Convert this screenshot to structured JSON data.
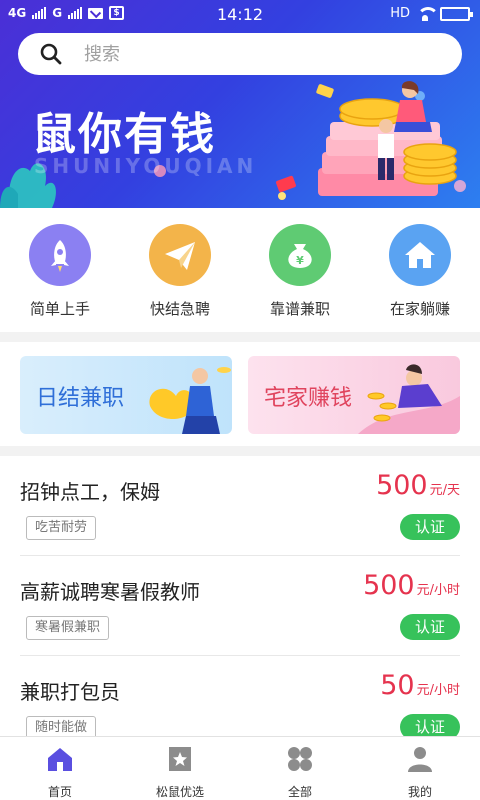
{
  "status_bar": {
    "network1": "4G",
    "network2": "G",
    "time": "14:12",
    "hd": "HD"
  },
  "search": {
    "placeholder": "搜索"
  },
  "banner": {
    "title": "鼠你有钱",
    "subtitle": "SHUNIYOUQIAN"
  },
  "categories": [
    {
      "label": "简单上手",
      "icon": "rocket-icon",
      "color": "#8b80f2"
    },
    {
      "label": "快结急聘",
      "icon": "paper-plane-icon",
      "color": "#f3b44a"
    },
    {
      "label": "靠谱兼职",
      "icon": "money-bag-icon",
      "color": "#5fcb73"
    },
    {
      "label": "在家躺赚",
      "icon": "home-icon",
      "color": "#5aa3f2"
    }
  ],
  "promos": [
    {
      "label": "日结兼职",
      "color": "#2f6fd8"
    },
    {
      "label": "宅家赚钱",
      "color": "#e0445e"
    }
  ],
  "jobs": [
    {
      "title": "招钟点工，保姆",
      "salary": "500",
      "unit": "元/天",
      "tag": "吃苦耐劳",
      "badge": "认证"
    },
    {
      "title": "高薪诚聘寒暑假教师",
      "salary": "500",
      "unit": "元/小时",
      "tag": "寒暑假兼职",
      "badge": "认证"
    },
    {
      "title": "兼职打包员",
      "salary": "50",
      "unit": "元/小时",
      "tag": "随时能做",
      "badge": "认证"
    }
  ],
  "bottom_nav": [
    {
      "label": "首页",
      "icon": "home-icon",
      "active": true
    },
    {
      "label": "松鼠优选",
      "icon": "star-icon",
      "active": false
    },
    {
      "label": "全部",
      "icon": "grid-icon",
      "active": false
    },
    {
      "label": "我的",
      "icon": "user-icon",
      "active": false
    }
  ],
  "colors": {
    "accent": "#5a4fe0",
    "salary": "#e5334e",
    "badge": "#37c25b"
  }
}
